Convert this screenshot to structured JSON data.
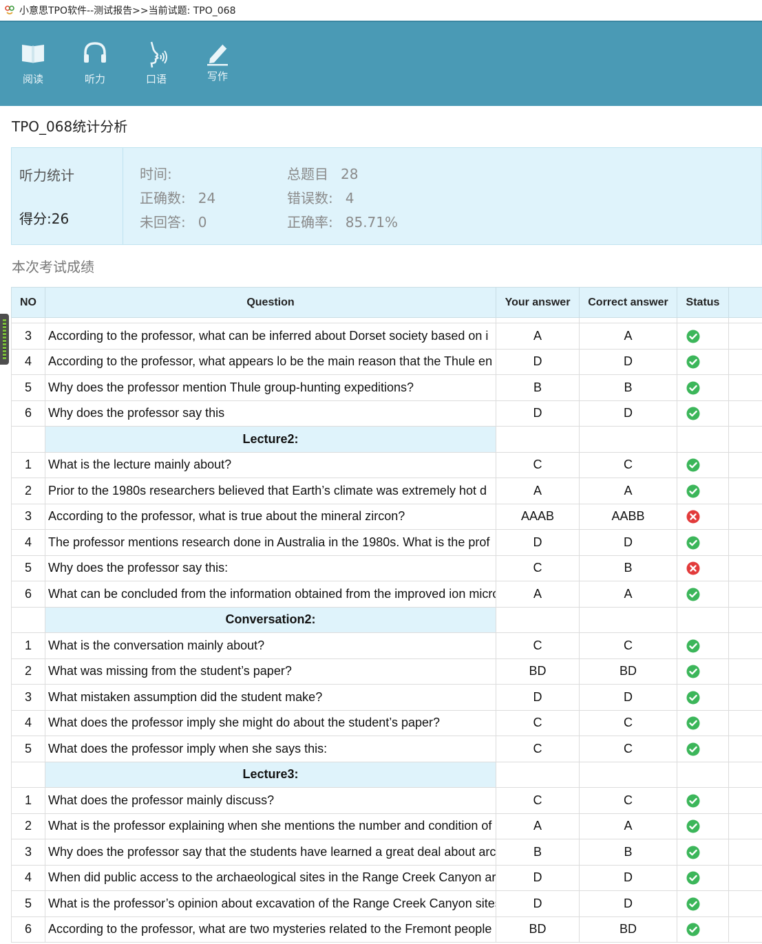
{
  "window": {
    "title": "小意思TPO软件--测试报告>>当前试题: TPO_068"
  },
  "toolbar": {
    "items": [
      {
        "label": "阅读",
        "icon": "book-icon"
      },
      {
        "label": "听力",
        "icon": "headphones-icon"
      },
      {
        "label": "口语",
        "icon": "speaking-icon"
      },
      {
        "label": "写作",
        "icon": "pen-icon"
      }
    ]
  },
  "page": {
    "title": "TPO_068统计分析"
  },
  "stats": {
    "section_label": "听力统计",
    "score_label": "得分:26",
    "time_label": "时间:",
    "total_label": "总题目",
    "total_value": "28",
    "correct_label": "正确数:",
    "correct_value": "24",
    "wrong_label": "错误数:",
    "wrong_value": "4",
    "unanswered_label": "未回答:",
    "unanswered_value": "0",
    "rate_label": "正确率:",
    "rate_value": "85.71%"
  },
  "results": {
    "heading": "本次考试成绩",
    "columns": {
      "no": "NO",
      "question": "Question",
      "your_answer": "Your answer",
      "correct_answer": "Correct answer",
      "status": "Status"
    },
    "status_colors": {
      "correct": "#3cb65a",
      "wrong": "#e23b3b"
    },
    "rows": [
      {
        "no": "3",
        "question": "According to the professor, what can be inferred about Dorset society based on i",
        "your": "A",
        "correct": "A",
        "status": "correct"
      },
      {
        "no": "4",
        "question": "According to the professor, what appears lo be the main reason that the Thule en",
        "your": "D",
        "correct": "D",
        "status": "correct"
      },
      {
        "no": "5",
        "question": "Why does the professor mention Thule group-hunting expeditions?",
        "your": "B",
        "correct": "B",
        "status": "correct"
      },
      {
        "no": "6",
        "question": "Why does the professor say this",
        "your": "D",
        "correct": "D",
        "status": "correct"
      },
      {
        "section": "Lecture2:"
      },
      {
        "no": "1",
        "question": "What is the lecture mainly about?",
        "your": "C",
        "correct": "C",
        "status": "correct"
      },
      {
        "no": "2",
        "question": "Prior to the 1980s researchers believed that Earth’s climate was extremely hot d",
        "your": "A",
        "correct": "A",
        "status": "correct"
      },
      {
        "no": "3",
        "question": "According to the professor, what is true about the mineral zircon?",
        "your": "AAAB",
        "correct": "AABB",
        "status": "wrong"
      },
      {
        "no": "4",
        "question": "The professor mentions research done in Australia in the 1980s. What is the prof",
        "your": "D",
        "correct": "D",
        "status": "correct"
      },
      {
        "no": "5",
        "question": "Why does the professor say this:",
        "your": "C",
        "correct": "B",
        "status": "wrong"
      },
      {
        "no": "6",
        "question": "What can be concluded from the information obtained from the improved ion microp",
        "your": "A",
        "correct": "A",
        "status": "correct"
      },
      {
        "section": "Conversation2:"
      },
      {
        "no": "1",
        "question": "What is the conversation mainly about?",
        "your": "C",
        "correct": "C",
        "status": "correct"
      },
      {
        "no": "2",
        "question": "What was missing from the student’s paper?",
        "your": "BD",
        "correct": "BD",
        "status": "correct"
      },
      {
        "no": "3",
        "question": "What mistaken assumption did the student make?",
        "your": "D",
        "correct": "D",
        "status": "correct"
      },
      {
        "no": "4",
        "question": "What does the professor imply she might do about the student’s paper?",
        "your": "C",
        "correct": "C",
        "status": "correct"
      },
      {
        "no": "5",
        "question": "What does the professor imply when she says this:",
        "your": "C",
        "correct": "C",
        "status": "correct"
      },
      {
        "section": "Lecture3:"
      },
      {
        "no": "1",
        "question": "What does the professor mainly discuss?",
        "your": "C",
        "correct": "C",
        "status": "correct"
      },
      {
        "no": "2",
        "question": "What is the professor explaining when she mentions the number and condition of a",
        "your": "A",
        "correct": "A",
        "status": "correct"
      },
      {
        "no": "3",
        "question": "Why does the professor say that the students have learned a great deal about arc",
        "your": "B",
        "correct": "B",
        "status": "correct"
      },
      {
        "no": "4",
        "question": "When did public access to the archaeological sites in the Range Creek Canyon are",
        "your": "D",
        "correct": "D",
        "status": "correct"
      },
      {
        "no": "5",
        "question": "What is the professor’s opinion about excavation of the Range Creek Canyon sites",
        "your": "D",
        "correct": "D",
        "status": "correct"
      },
      {
        "no": "6",
        "question": "According to the professor, what are two mysteries related to the Fremont people",
        "your": "BD",
        "correct": "BD",
        "status": "correct"
      }
    ]
  }
}
